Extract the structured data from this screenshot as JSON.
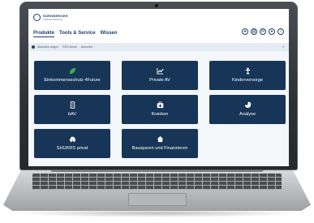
{
  "app": {
    "logo_line1": "NÜRNBERGER",
    "logo_line2": "VERSICHERUNG"
  },
  "nav": {
    "items": [
      "Produkte",
      "Tools & Service",
      "Wissen"
    ]
  },
  "toolbar": {
    "icons": [
      "user-icon",
      "document-icon",
      "mail-icon",
      "lock-icon",
      "info-icon"
    ]
  },
  "subbar": {
    "items": [
      "Aktuelles zeigen",
      "RSS-News",
      "Aktuelles"
    ]
  },
  "tiles": [
    {
      "label": "Einkommensschutz 4Future",
      "icon": "leaf-icon",
      "accent": "#3fae49"
    },
    {
      "label": "Private AV",
      "icon": "trend-chart-icon",
      "accent": "#ffffff"
    },
    {
      "label": "Kindervorsorge",
      "icon": "child-icon",
      "accent": "#ffffff"
    },
    {
      "label": "bAV",
      "icon": "building-icon",
      "accent": "#ffffff"
    },
    {
      "label": "Kranken",
      "icon": "medical-bag-icon",
      "accent": "#ffffff"
    },
    {
      "label": "Analyse",
      "icon": "pie-chart-icon",
      "accent": "#ffffff"
    },
    {
      "label": "SHUKRS privat",
      "icon": "car-icon",
      "accent": "#ffffff"
    },
    {
      "label": "Bausparen und Finanzieren",
      "icon": "house-icon",
      "accent": "#ffffff"
    }
  ],
  "colors": {
    "tile_bg": "#173556",
    "brand": "#1e3f66",
    "subbar_bg": "#e4ebf2"
  }
}
